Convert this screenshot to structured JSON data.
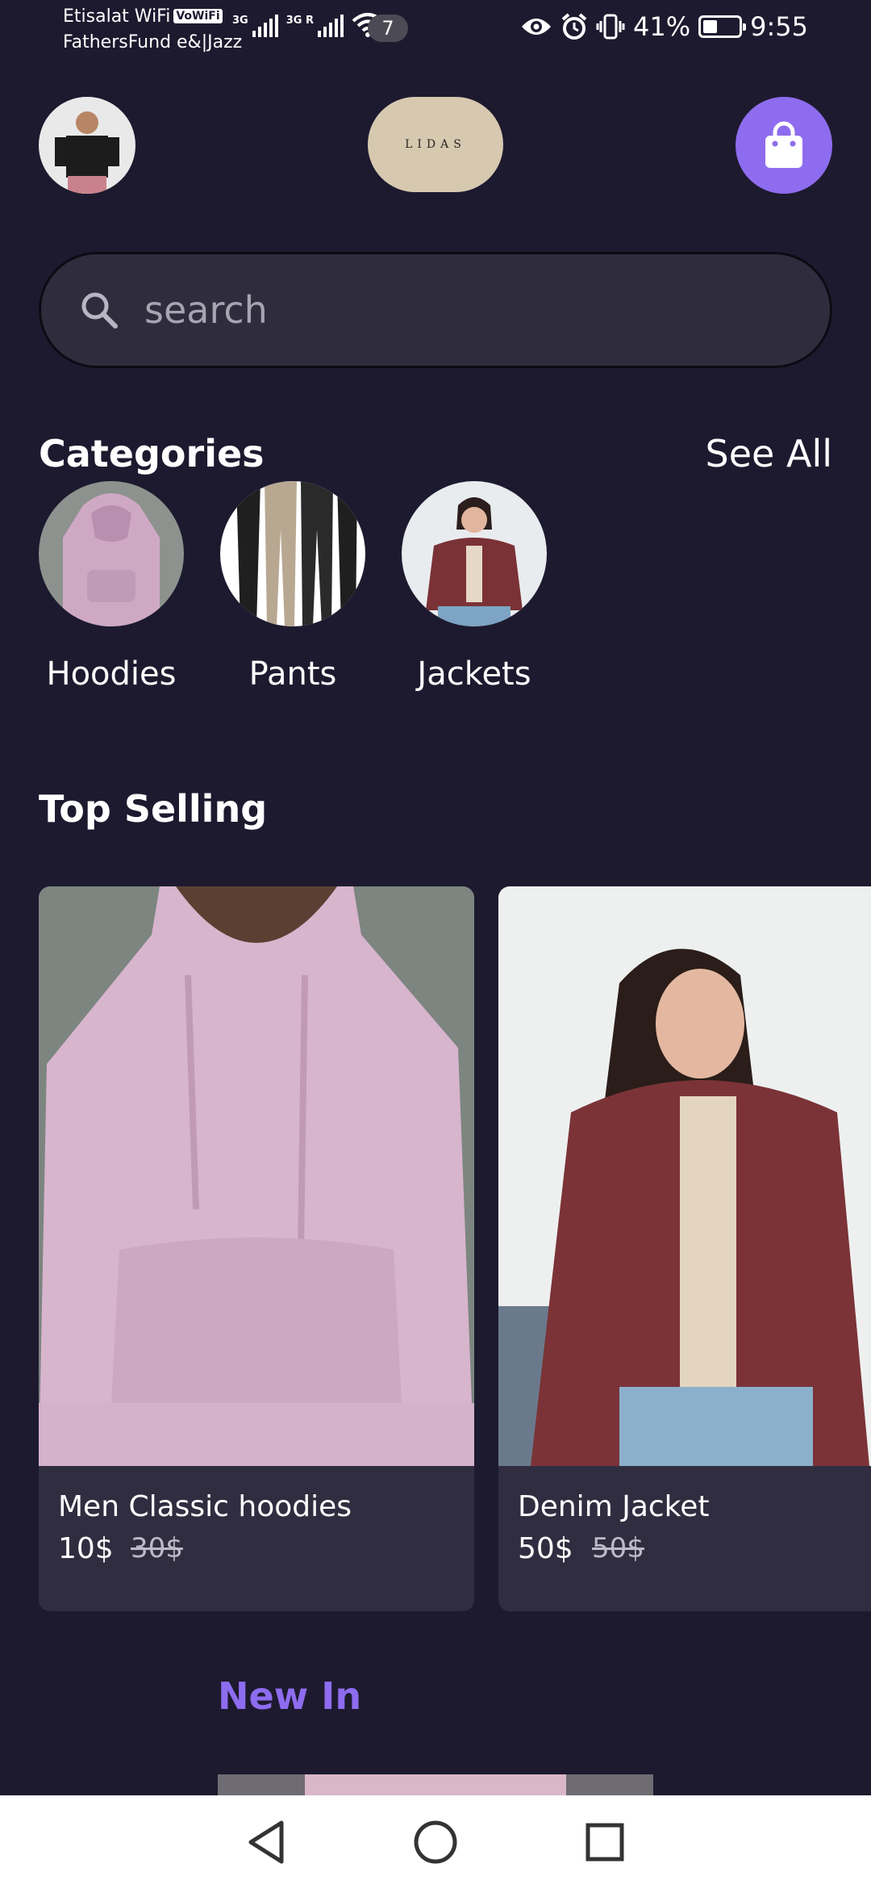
{
  "status_bar": {
    "carrier_line_1": "Etisalat WiFi",
    "vowifi_badge": "VoWiFi",
    "carrier_line_2": "FathersFund e&|Jazz",
    "signal_1_label": "3G",
    "signal_2_label": "3G R",
    "notification_count": "7",
    "battery_percent": "41%",
    "battery_level": 0.41,
    "time": "9:55"
  },
  "header": {
    "logo_text": "LIDAS"
  },
  "search": {
    "placeholder": "search"
  },
  "categories": {
    "title": "Categories",
    "see_all_label": "See All",
    "items": [
      {
        "label": "Hoodies"
      },
      {
        "label": "Pants"
      },
      {
        "label": "Jackets"
      }
    ]
  },
  "top_selling": {
    "title": "Top Selling",
    "products": [
      {
        "name": "Men Classic hoodies",
        "price": "10$",
        "old_price": "30$"
      },
      {
        "name": "Denim Jacket",
        "price": "50$",
        "old_price": "50$"
      }
    ]
  },
  "new_in": {
    "title": "New In"
  },
  "colors": {
    "background": "#1d1a2f",
    "accent": "#8e6cef",
    "card": "#302d40"
  }
}
